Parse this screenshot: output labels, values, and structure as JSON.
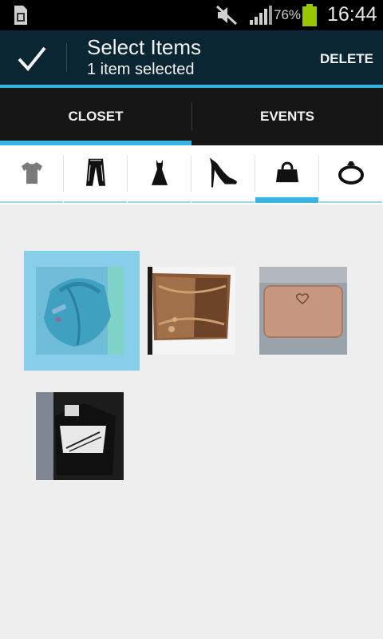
{
  "status_bar": {
    "battery_percent": "76%",
    "time": "16:44"
  },
  "action_bar": {
    "title": "Select Items",
    "subtitle": "1 item selected",
    "delete_label": "DELETE"
  },
  "tabs": [
    {
      "label": "CLOSET",
      "selected": true
    },
    {
      "label": "EVENTS",
      "selected": false
    }
  ],
  "categories": [
    {
      "icon": "tshirt-icon",
      "active": false
    },
    {
      "icon": "pants-icon",
      "active": false
    },
    {
      "icon": "dress-icon",
      "active": false
    },
    {
      "icon": "high-heel-icon",
      "active": false
    },
    {
      "icon": "handbag-icon",
      "active": true
    },
    {
      "icon": "ring-icon",
      "active": false
    }
  ],
  "items": [
    {
      "name": "teal backpack",
      "selected": true
    },
    {
      "name": "brown bucket bag",
      "selected": false
    },
    {
      "name": "tan wallet",
      "selected": false
    },
    {
      "name": "black and white bag",
      "selected": false
    }
  ],
  "colors": {
    "accent": "#33b5e5",
    "action_bar": "#0b2633",
    "tab_bar": "#161616",
    "selection": "#87ceeb"
  }
}
